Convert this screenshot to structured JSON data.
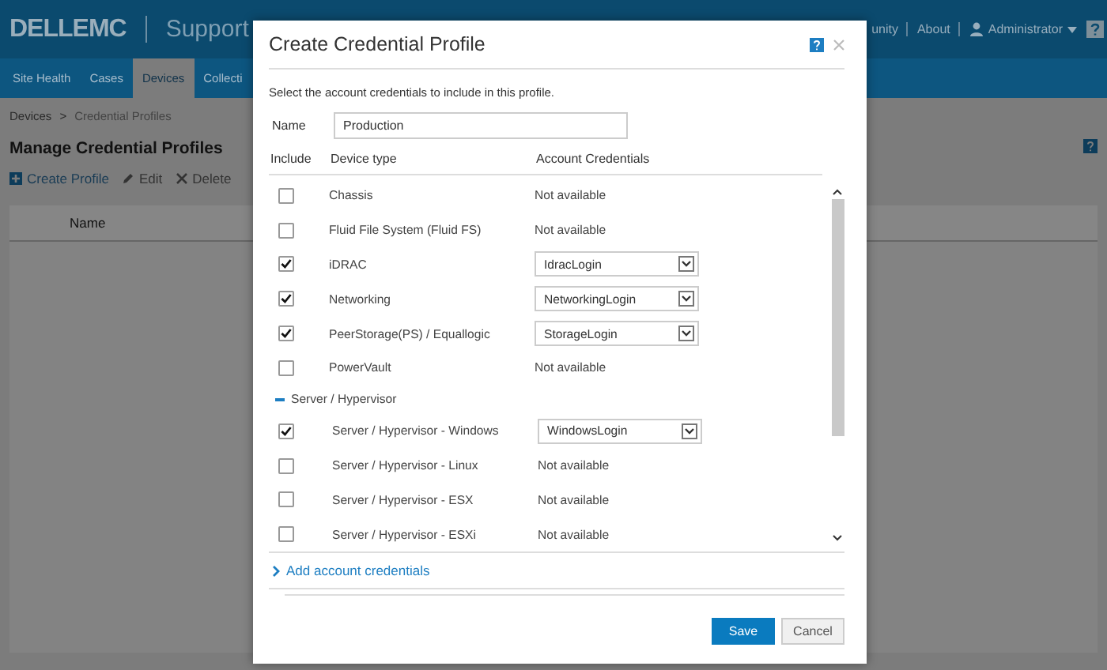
{
  "header": {
    "logo": "DELLEMC",
    "product": "Support",
    "links": [
      "unity",
      "About"
    ],
    "user": "Administrator"
  },
  "nav_tabs": [
    {
      "label": "Site Health",
      "selected": false
    },
    {
      "label": "Cases",
      "selected": false
    },
    {
      "label": "Devices",
      "selected": true
    },
    {
      "label": "Collecti",
      "selected": false
    }
  ],
  "breadcrumb": [
    "Devices",
    ">",
    "Credential Profiles"
  ],
  "page_title": "Manage Credential Profiles",
  "toolbar": [
    "Create Profile",
    "Edit",
    "Delete"
  ],
  "table": {
    "columns": [
      "Name"
    ]
  },
  "dialog": {
    "title": "Create Credential Profile",
    "instruction": "Select the account credentials to include in this profile.",
    "name_label": "Name",
    "name_value": "Production",
    "columns": [
      "Include",
      "Device type",
      "Account Credentials"
    ],
    "rows": [
      {
        "kind": "device",
        "device_type": "Chassis",
        "checked": false,
        "credential": {
          "kind": "text",
          "text": "Not available"
        }
      },
      {
        "kind": "device",
        "device_type": "Fluid File System (Fluid FS)",
        "checked": false,
        "credential": {
          "kind": "text",
          "text": "Not available"
        }
      },
      {
        "kind": "device",
        "device_type": "iDRAC",
        "checked": true,
        "credential": {
          "kind": "select",
          "value": "IdracLogin"
        }
      },
      {
        "kind": "device",
        "device_type": "Networking",
        "checked": true,
        "credential": {
          "kind": "select",
          "value": "NetworkingLogin"
        }
      },
      {
        "kind": "device",
        "device_type": "PeerStorage(PS) / Equallogic",
        "checked": true,
        "credential": {
          "kind": "select",
          "value": "StorageLogin"
        }
      },
      {
        "kind": "device",
        "device_type": "PowerVault",
        "checked": false,
        "credential": {
          "kind": "text",
          "text": "Not available"
        }
      },
      {
        "kind": "group",
        "label": "Server / Hypervisor",
        "expanded": true,
        "children": [
          {
            "kind": "device",
            "device_type": "Server / Hypervisor - Windows",
            "checked": true,
            "credential": {
              "kind": "select",
              "value": "WindowsLogin"
            }
          },
          {
            "kind": "device",
            "device_type": "Server / Hypervisor - Linux",
            "checked": false,
            "credential": {
              "kind": "text",
              "text": "Not available"
            }
          },
          {
            "kind": "device",
            "device_type": "Server / Hypervisor - ESX",
            "checked": false,
            "credential": {
              "kind": "text",
              "text": "Not available"
            }
          },
          {
            "kind": "device",
            "device_type": "Server / Hypervisor - ESXi",
            "checked": false,
            "credential": {
              "kind": "text",
              "text": "Not available"
            }
          }
        ]
      }
    ],
    "add_link": "Add account credentials",
    "buttons": [
      {
        "label": "Save",
        "kind": "primary"
      },
      {
        "label": "Cancel",
        "kind": "secondary"
      }
    ]
  }
}
